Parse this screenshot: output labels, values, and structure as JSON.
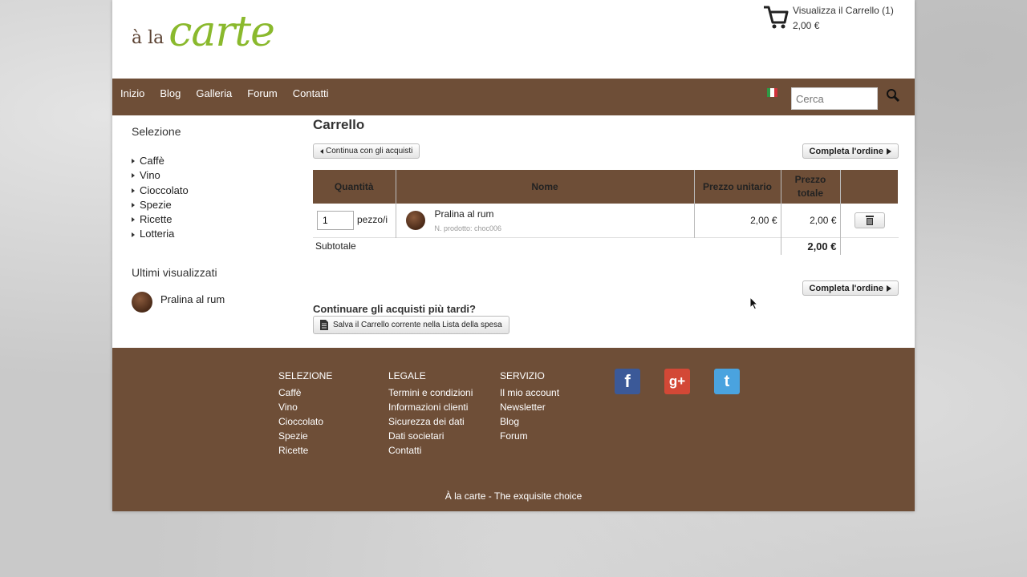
{
  "logo": {
    "small": "à la",
    "big": "carte"
  },
  "cart": {
    "link_text": "Visualizza il Carrello (1)",
    "total": "2,00 €"
  },
  "nav": {
    "items": [
      "Inizio",
      "Blog",
      "Galleria",
      "Forum",
      "Contatti"
    ]
  },
  "search": {
    "placeholder": "Cerca"
  },
  "colors": {
    "brand_brown": "#6e4e37",
    "logo_green": "#8ab92d"
  },
  "sidebar": {
    "title": "Selezione",
    "items": [
      "Caffè",
      "Vino",
      "Cioccolato",
      "Spezie",
      "Ricette",
      "Lotteria"
    ],
    "recent_title": "Ultimi visualizzati",
    "recent_item": "Pralina al rum"
  },
  "main": {
    "title": "Carrello",
    "continue_label": "Continua con gli acquisti",
    "complete_label": "Completa l'ordine",
    "columns": [
      "Quantità",
      "Nome",
      "Prezzo unitario",
      "Prezzo totale",
      ""
    ],
    "row": {
      "quantity": "1",
      "unit": "pezzo/i",
      "name": "Pralina al rum",
      "sku": "N. prodotto: choc006",
      "unit_price": "2,00 €",
      "total_price": "2,00 €"
    },
    "subtotal_label": "Subtotale",
    "subtotal_value": "2,00 €",
    "later_title": "Continuare gli acquisti più tardi?",
    "save_label": "Salva il Carrello corrente nella Lista della spesa"
  },
  "footer": {
    "col1": {
      "title": "SELEZIONE",
      "links": [
        "Caffè",
        "Vino",
        "Cioccolato",
        "Spezie",
        "Ricette"
      ]
    },
    "col2": {
      "title": "LEGALE",
      "links": [
        "Termini e condizioni",
        "Informazioni clienti",
        "Sicurezza dei dati",
        "Dati societari",
        "Contatti"
      ]
    },
    "col3": {
      "title": "SERVIZIO",
      "links": [
        "Il mio account",
        "Newsletter",
        "Blog",
        "Forum"
      ]
    },
    "social": {
      "facebook": "f",
      "google": "g+",
      "twitter": "t"
    },
    "tagline": "À la carte - The exquisite choice"
  }
}
